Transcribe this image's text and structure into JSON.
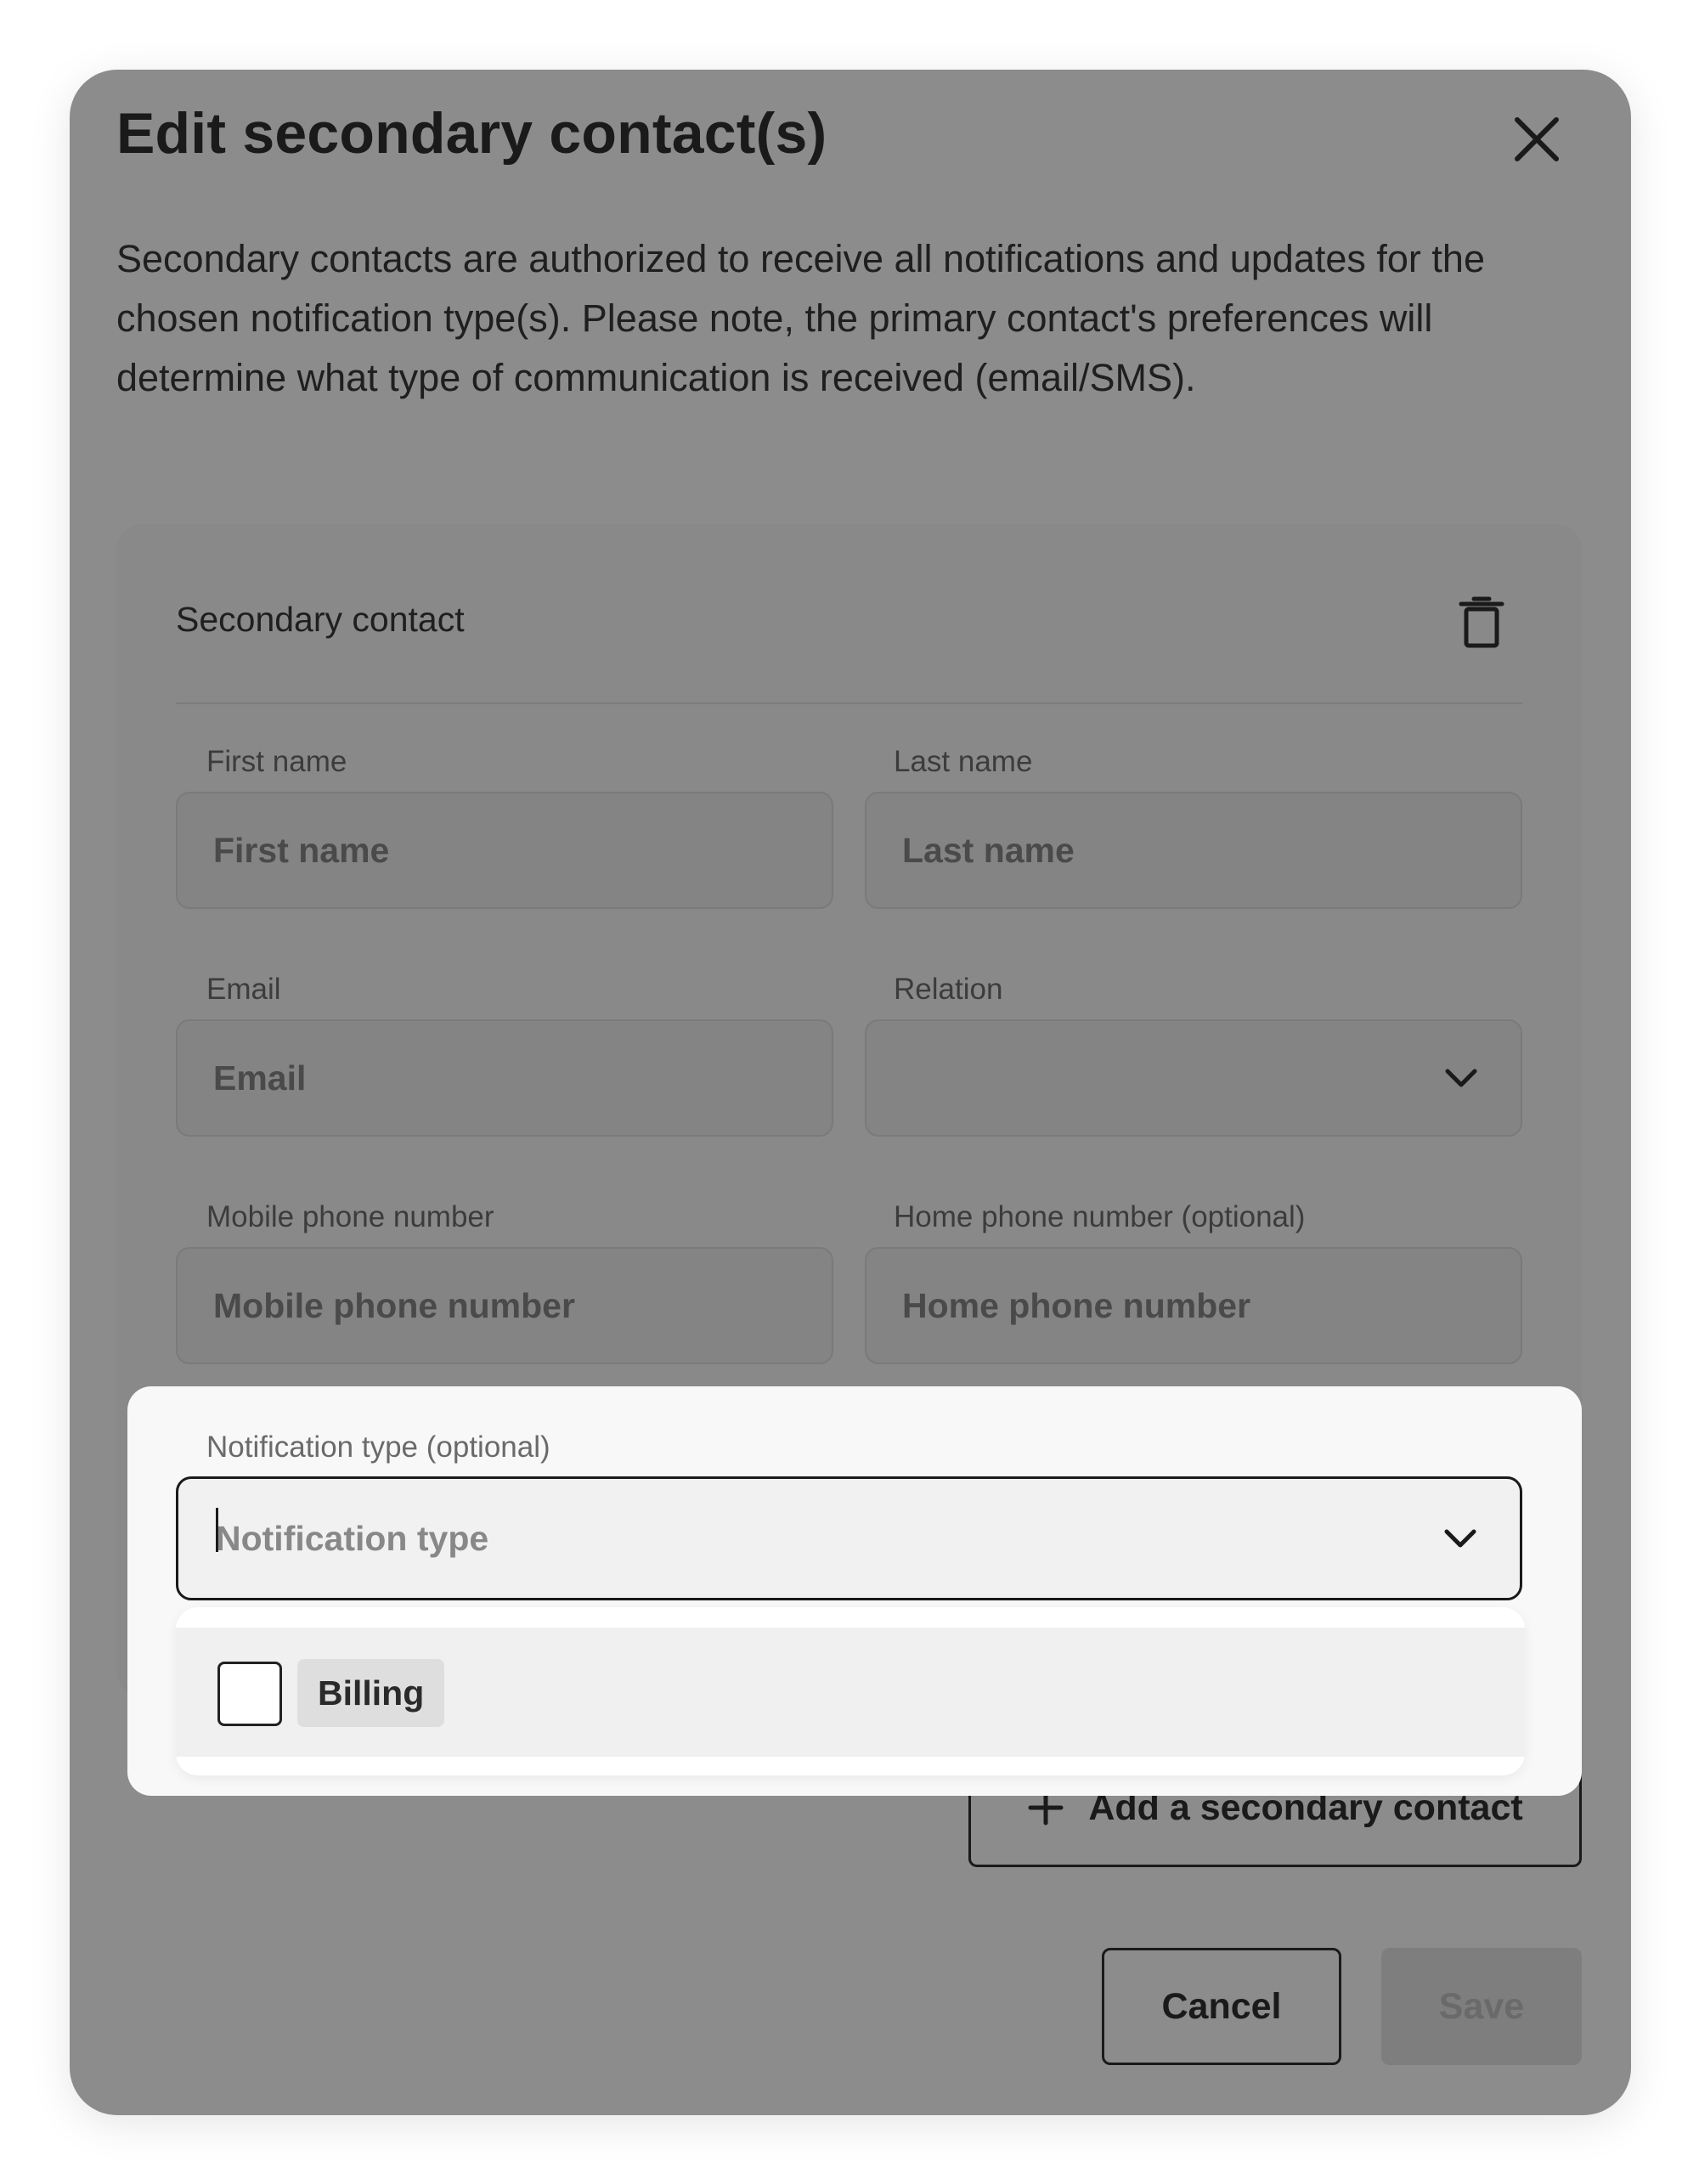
{
  "dialog": {
    "title": "Edit secondary contact(s)",
    "description": "Secondary contacts are authorized to receive all notifications and updates for the chosen notification type(s). Please note, the primary contact's preferences will determine what type of communication is received (email/SMS)."
  },
  "contact_card": {
    "title": "Secondary contact",
    "first_name": {
      "label": "First name",
      "placeholder": "First name",
      "value": ""
    },
    "last_name": {
      "label": "Last name",
      "placeholder": "Last name",
      "value": ""
    },
    "email": {
      "label": "Email",
      "placeholder": "Email",
      "value": ""
    },
    "relation": {
      "label": "Relation",
      "selected": ""
    },
    "mobile_phone": {
      "label": "Mobile phone number",
      "placeholder": "Mobile phone number",
      "value": ""
    },
    "home_phone": {
      "label": "Home phone number (optional)",
      "placeholder": "Home phone number",
      "value": ""
    },
    "notification_type": {
      "label": "Notification type (optional)",
      "placeholder": "Notification type",
      "options": [
        {
          "label": "Billing",
          "checked": false
        }
      ]
    }
  },
  "actions": {
    "add_label": "Add a secondary contact",
    "cancel_label": "Cancel",
    "save_label": "Save"
  },
  "icons": {
    "close": "close-icon",
    "delete": "trash-icon",
    "dropdown": "chevron-down-icon",
    "add": "plus-icon"
  }
}
